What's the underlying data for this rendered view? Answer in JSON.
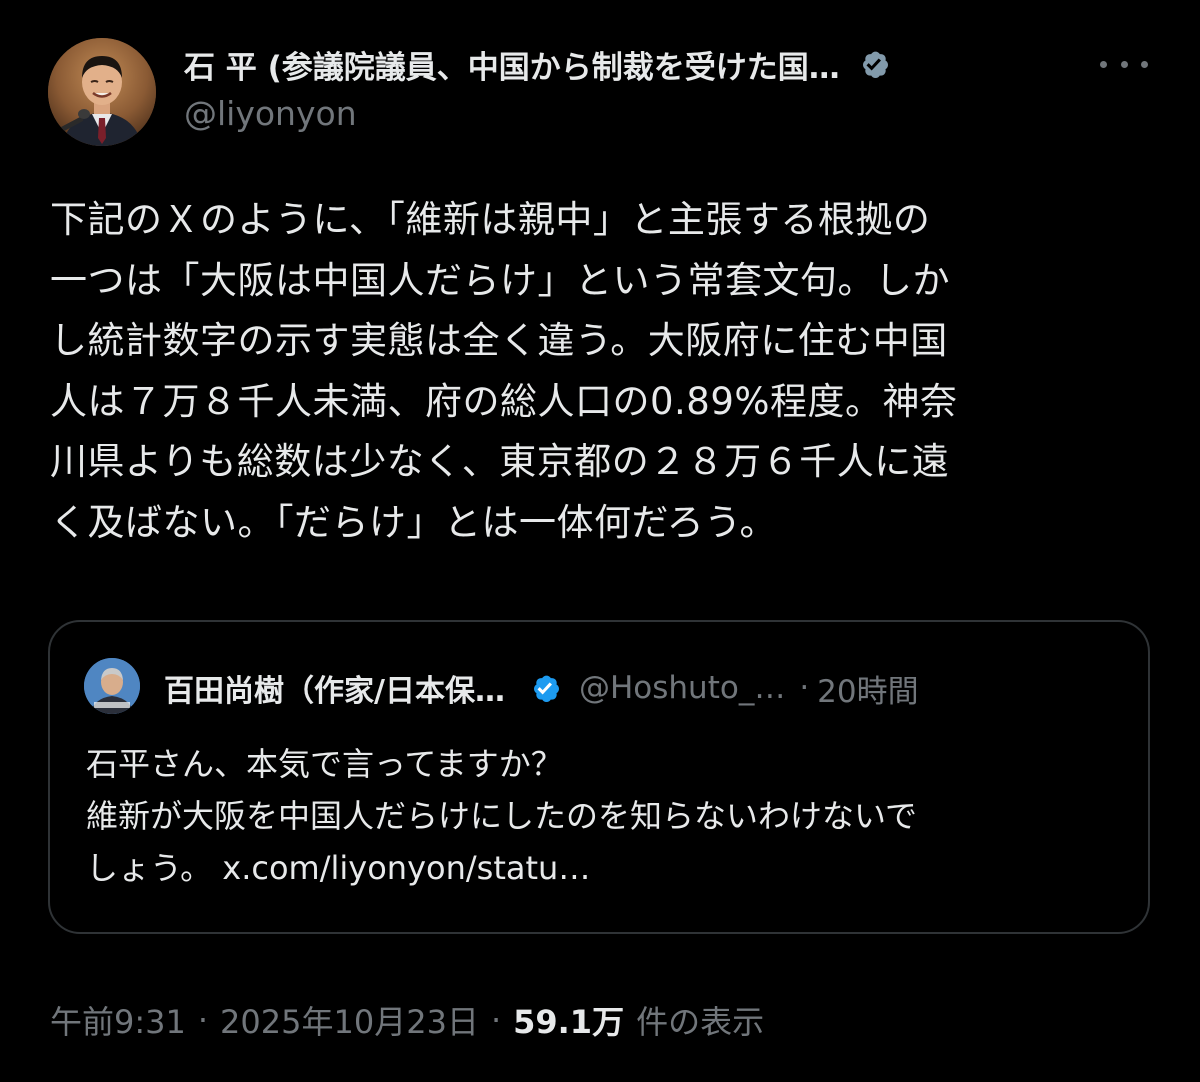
{
  "post": {
    "author": {
      "display_name": "石 平 (参議院議員、中国から制裁を受けた国…",
      "handle": "@liyonyon",
      "verified_badge_color": "#829aab"
    },
    "text": "下記のＸのように、「維新は親中」と主張する根拠の\n一つは「大阪は中国人だらけ」という常套文句。しか\nし統計数字の示す実態は全く違う。大阪府に住む中国\n人は７万８千人未満、府の総人口の0.89%程度。神奈\n川県よりも総数は少なく、東京都の２８万６千人に遠\nく及ばない。「だらけ」とは一体何だろう。",
    "quoted": {
      "display_name": "百田尚樹（作家/日本保…",
      "handle": "@Hoshuto_…",
      "separator": "·",
      "time": "20時間",
      "verified_badge_color": "#1d9bf0",
      "text": "石平さん、本気で言ってますか？\n維新が大阪を中国人だらけにしたのを知らないわけないで\nしょう。 ",
      "link": "x.com/liyonyon/statu…"
    },
    "meta": {
      "time": "午前9:31",
      "separator": "·",
      "date": "2025年10月23日",
      "views_count": "59.1万",
      "views_label": "件の表示"
    }
  },
  "icons": {
    "more": "more-horizontal-icon",
    "verified": "verified-badge-icon"
  },
  "colors": {
    "background": "#000000",
    "text_primary": "#e7e9ea",
    "text_secondary": "#71767b",
    "border": "#2f3336",
    "blue": "#1d9bf0"
  }
}
